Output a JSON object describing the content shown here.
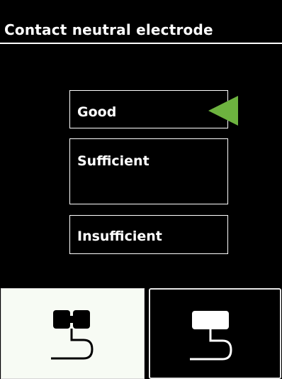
{
  "header": {
    "title": "Contact neutral electrode"
  },
  "contact_levels": [
    {
      "label": "Good",
      "selected": true
    },
    {
      "label": "Sufficient",
      "selected": false
    },
    {
      "label": "Insufficient",
      "selected": false
    }
  ],
  "electrode_buttons": [
    {
      "icon": "split-electrode-icon",
      "selected": true
    },
    {
      "icon": "single-electrode-icon",
      "selected": false
    }
  ],
  "colors": {
    "background": "#000000",
    "text": "#ffffff",
    "indicator": "#6db33f",
    "selected_button": "#f7fbf4"
  }
}
